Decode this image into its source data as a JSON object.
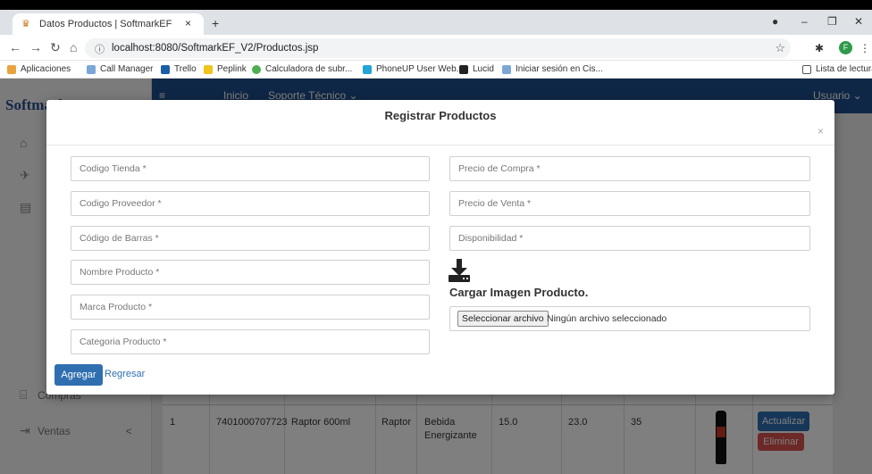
{
  "browser": {
    "tab_title": "Datos Productos | SoftmarkEF",
    "tab_close": "×",
    "new_tab": "+",
    "url": "localhost:8080/SoftmarkEF_V2/Productos.jsp",
    "profile_initial": "F",
    "bookmarks": [
      "Aplicaciones",
      "Call Manager",
      "Trello",
      "Peplink",
      "Calculadora de subr...",
      "PhoneUP User Web...",
      "Lucid",
      "Iniciar sesión en Cis..."
    ],
    "reading_list": "Lista de lectura"
  },
  "app": {
    "logo": "SoftmarkEF",
    "nav": {
      "inicio": "Inicio",
      "soporte": "Soporte Técnico ⌄",
      "user": "Usuario ⌄"
    },
    "sidebar": {
      "compras": "Compras",
      "ventas": "Ventas",
      "ventas_arrow": "<"
    }
  },
  "table": {
    "row": {
      "num": "1",
      "codigo": "7401000707723",
      "nombre": "Raptor 600ml",
      "marca": "Raptor",
      "categoria": "Bebida Energizante",
      "compra": "15.0",
      "venta": "23.0",
      "disponibilidad": "35"
    },
    "actualizar": "Actualizar",
    "eliminar": "Eliminar"
  },
  "modal": {
    "title": "Registrar Productos",
    "close": "×",
    "fields": {
      "codigo_tienda": "Codigo Tienda *",
      "codigo_proveedor": "Codigo Proveedor *",
      "codigo_barras": "Código de Barras *",
      "nombre_producto": "Nombre Producto *",
      "marca_producto": "Marca Producto *",
      "categoria_producto": "Categoria Producto *",
      "precio_compra": "Precio de Compra *",
      "precio_venta": "Precio de Venta *",
      "disponibilidad": "Disponibilidad *"
    },
    "upload_title": "Cargar Imagen Producto.",
    "file_button": "Seleccionar archivo",
    "file_status": "Ningún archivo seleccionado",
    "add_button": "Agregar",
    "back_link": "Regresar"
  }
}
